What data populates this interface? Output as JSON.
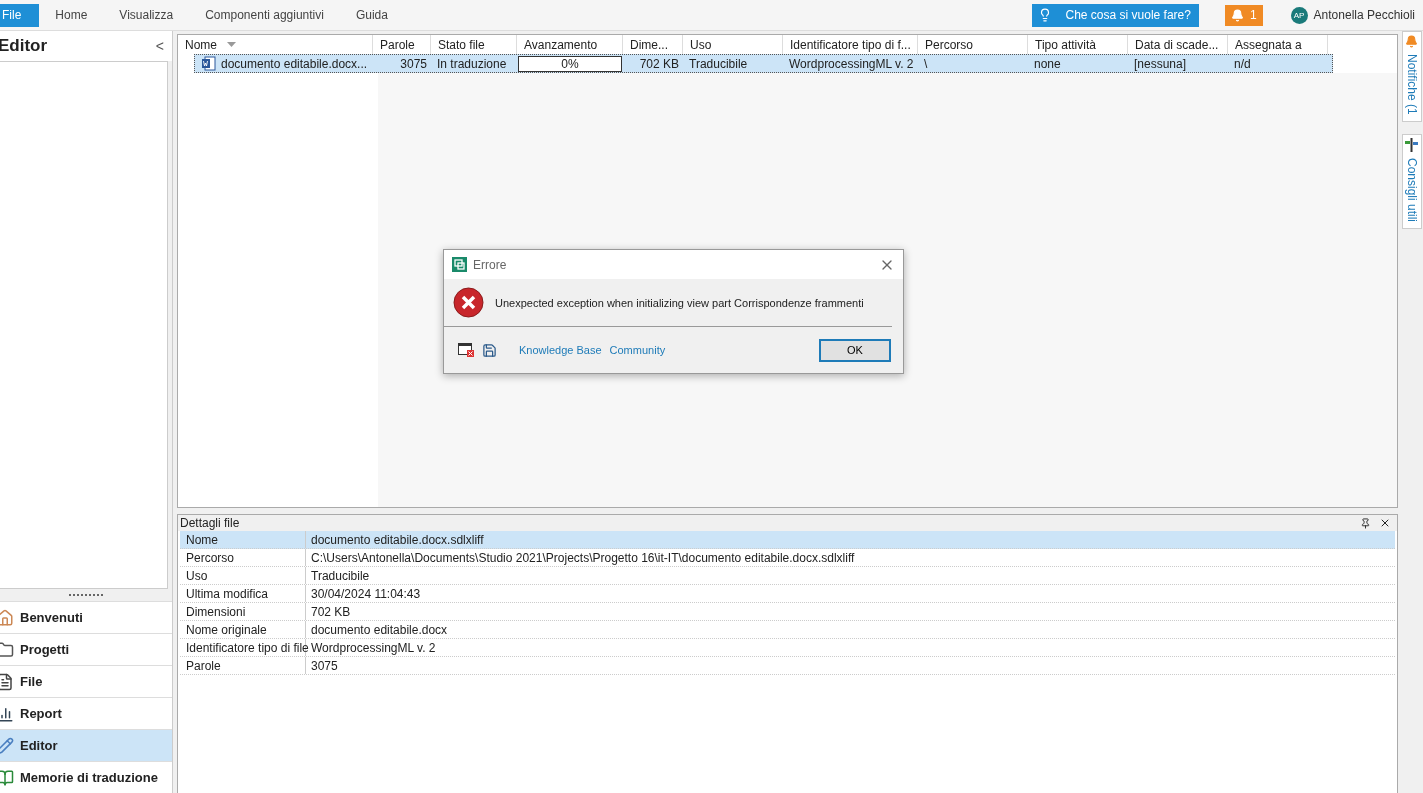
{
  "menu": [
    {
      "label": "File",
      "selected": true
    },
    {
      "label": "Home",
      "selected": false
    },
    {
      "label": "Visualizza",
      "selected": false
    },
    {
      "label": "Componenti aggiuntivi",
      "selected": false
    },
    {
      "label": "Guida",
      "selected": false
    }
  ],
  "tell_me": "Che cosa si vuole fare?",
  "notifications_count": "1",
  "user": {
    "initials": "AP",
    "name": "Antonella Pecchioli"
  },
  "sidebar": {
    "title": "Editor",
    "collapse": "<",
    "items": [
      {
        "label": "Benvenuti",
        "kind": "home",
        "selected": false
      },
      {
        "label": "Progetti",
        "kind": "folder",
        "selected": false
      },
      {
        "label": "File",
        "kind": "file",
        "selected": false
      },
      {
        "label": "Report",
        "kind": "report",
        "selected": false
      },
      {
        "label": "Editor",
        "kind": "editor",
        "selected": true
      },
      {
        "label": "Memorie di traduzione",
        "kind": "memory",
        "selected": false
      }
    ]
  },
  "files_table": {
    "columns": [
      "Nome",
      "Parole",
      "Stato file",
      "Avanzamento",
      "Dime...",
      "Uso",
      "Identificatore tipo di f...",
      "Percorso",
      "Tipo attività",
      "Data di scade...",
      "Assegnata a"
    ],
    "rows": [
      {
        "selected": true,
        "name": "documento editabile.docx...",
        "words": "3075",
        "status": "In traduzione",
        "progress": {
          "level": 0,
          "text": "0%"
        },
        "size": "702 KB",
        "use": "Traducibile",
        "file_type": "WordprocessingML v. 2",
        "path": "\\",
        "task_type": "none",
        "due_date": "[nessuna]",
        "assigned": "n/d"
      }
    ]
  },
  "details": {
    "title": "Dettagli file",
    "rows": [
      {
        "key": "Nome",
        "value": "documento editabile.docx.sdlxliff",
        "selected": true
      },
      {
        "key": "Percorso",
        "value": "C:\\Users\\Antonella\\Documents\\Studio 2021\\Projects\\Progetto 16\\it-IT\\documento editabile.docx.sdlxliff",
        "selected": false
      },
      {
        "key": "Uso",
        "value": "Traducibile",
        "selected": false
      },
      {
        "key": "Ultima modifica",
        "value": "30/04/2024 11:04:43",
        "selected": false
      },
      {
        "key": "Dimensioni",
        "value": "702 KB",
        "selected": false
      },
      {
        "key": "Nome originale",
        "value": "documento editabile.docx",
        "selected": false
      },
      {
        "key": "Identificatore tipo di file",
        "value": "WordprocessingML v. 2",
        "selected": false
      },
      {
        "key": "Parole",
        "value": "3075",
        "selected": false
      }
    ]
  },
  "right_tabs": [
    {
      "label": "Notifiche (1",
      "kind": "bell"
    },
    {
      "label": "Consigli utili",
      "kind": "tips"
    }
  ],
  "dialog": {
    "title": "Errore",
    "message": "Unexpected exception when initializing view part Corrispondenze frammenti",
    "links": [
      "Knowledge Base",
      "Community"
    ],
    "button": "OK"
  }
}
